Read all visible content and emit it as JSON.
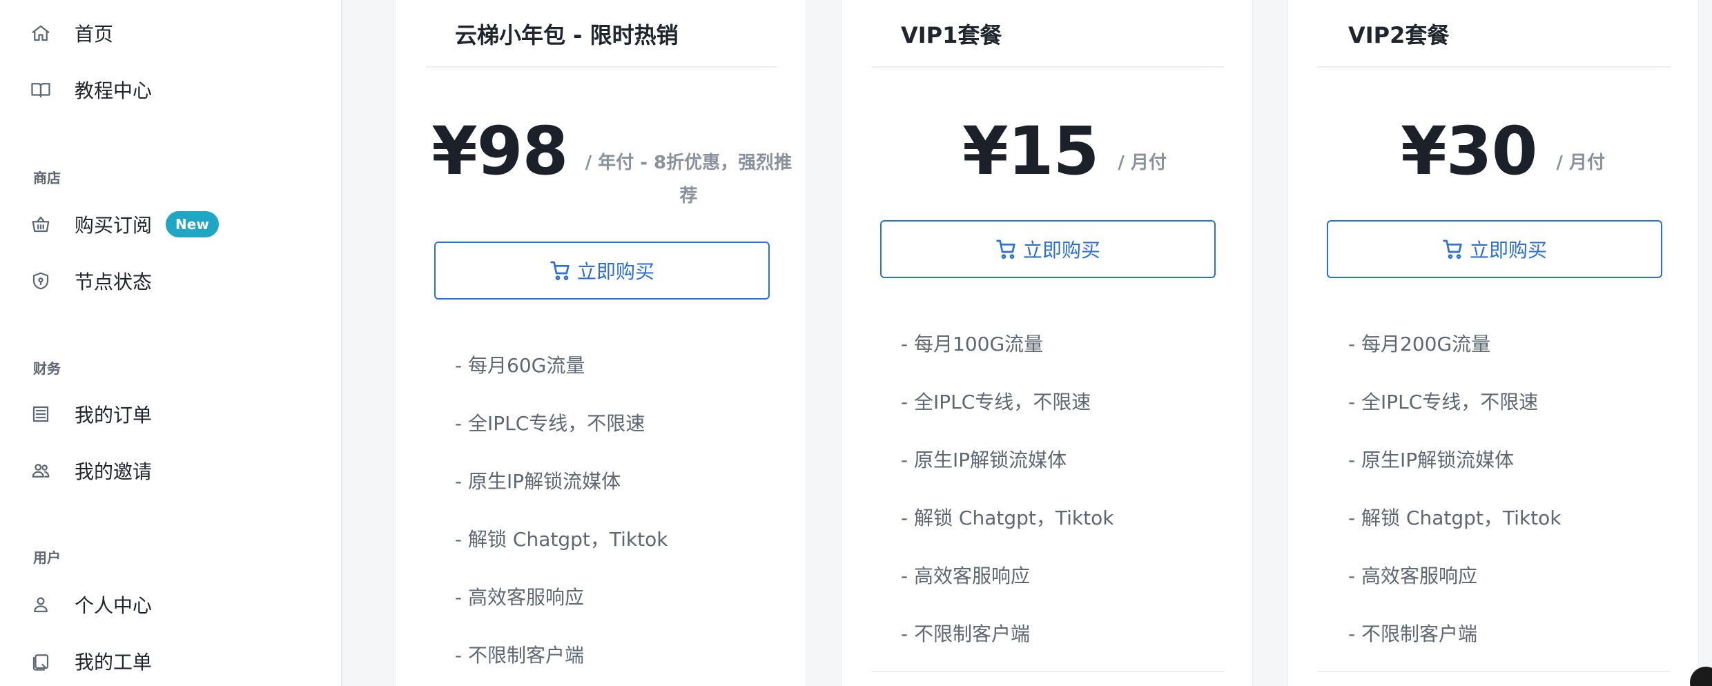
{
  "sidebar": {
    "items": [
      {
        "label": "首页",
        "icon": "home-icon"
      },
      {
        "label": "教程中心",
        "icon": "book-icon"
      }
    ],
    "sections": [
      {
        "title": "商店",
        "items": [
          {
            "label": "购买订阅",
            "icon": "basket-icon",
            "badge": "New"
          },
          {
            "label": "节点状态",
            "icon": "shield-icon"
          }
        ]
      },
      {
        "title": "财务",
        "items": [
          {
            "label": "我的订单",
            "icon": "receipt-icon"
          },
          {
            "label": "我的邀请",
            "icon": "users-icon"
          }
        ]
      },
      {
        "title": "用户",
        "items": [
          {
            "label": "个人中心",
            "icon": "user-icon"
          },
          {
            "label": "我的工单",
            "icon": "ticket-icon"
          }
        ]
      }
    ]
  },
  "plans": [
    {
      "title": "云梯小年包 - 限时热销",
      "price": "¥98",
      "period": "/ 年付 - 8折优惠，强烈推荐",
      "button": "立即购买",
      "features": [
        "- 每月60G流量",
        "- 全IPLC专线，不限速",
        "- 原生IP解锁流媒体",
        "- 解锁 Chatgpt，Tiktok",
        "- 高效客服响应",
        "- 不限制客户端"
      ]
    },
    {
      "title": "VIP1套餐",
      "price": "¥15",
      "period": "/ 月付",
      "button": "立即购买",
      "features": [
        "- 每月100G流量",
        "- 全IPLC专线，不限速",
        "- 原生IP解锁流媒体",
        "- 解锁 Chatgpt，Tiktok",
        "- 高效客服响应",
        "- 不限制客户端"
      ]
    },
    {
      "title": "VIP2套餐",
      "price": "¥30",
      "period": "/ 月付",
      "button": "立即购买",
      "features": [
        "- 每月200G流量",
        "- 全IPLC专线，不限速",
        "- 原生IP解锁流媒体",
        "- 解锁 Chatgpt，Tiktok",
        "- 高效客服响应",
        "- 不限制客户端"
      ]
    }
  ],
  "colors": {
    "accent": "#2b6fd6",
    "badge": "#1fa6c4"
  }
}
